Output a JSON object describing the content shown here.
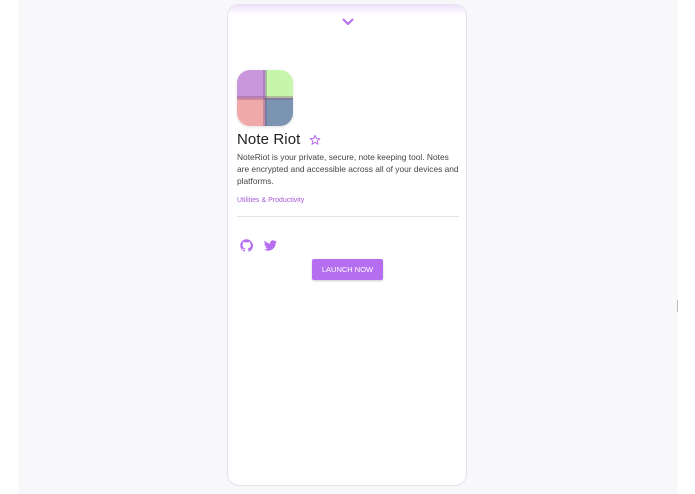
{
  "app": {
    "name": "Note Riot",
    "description": "NoteRiot is your private, secure, note keeping tool. Notes are encrypted and accessible across all of your devices and platforms.",
    "category": "Utilities & Productivity",
    "launch_label": "LAUNCH NOW"
  },
  "icons": {
    "collapse": "chevron-down-icon",
    "favorite": "star-outline-icon",
    "github": "github-icon",
    "twitter": "twitter-icon"
  },
  "colors": {
    "accent": "#b56ef0",
    "link": "#a45bd6",
    "icon_quadrants": [
      "#c996dc",
      "#c6f6ab",
      "#f0a9a9",
      "#7b94b1"
    ]
  }
}
